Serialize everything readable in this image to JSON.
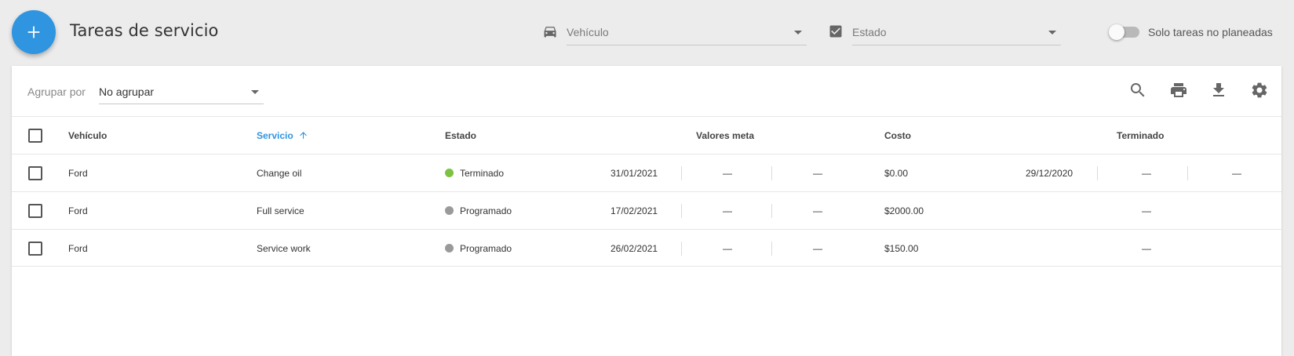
{
  "header": {
    "title": "Tareas de servicio",
    "vehicle_filter_placeholder": "Vehículo",
    "status_filter_placeholder": "Estado",
    "unplanned_toggle_label": "Solo tareas no planeadas",
    "unplanned_toggle_on": false
  },
  "toolbar": {
    "group_by_label": "Agrupar por",
    "group_by_value": "No agrupar"
  },
  "table": {
    "columns": {
      "vehicle": "Vehículo",
      "service": "Servicio",
      "status": "Estado",
      "target_values": "Valores meta",
      "cost": "Costo",
      "finished": "Terminado"
    },
    "rows": [
      {
        "vehicle": "Ford",
        "service": "Change oil",
        "status": "Terminado",
        "status_color": "#7dc242",
        "target_date": "31/01/2021",
        "target_v1": "—",
        "target_v2": "—",
        "cost": "$0.00",
        "finished_date": "29/12/2020",
        "finished_v1": "—",
        "finished_v2": "—"
      },
      {
        "vehicle": "Ford",
        "service": "Full service",
        "status": "Programado",
        "status_color": "#9a9a9a",
        "target_date": "17/02/2021",
        "target_v1": "—",
        "target_v2": "—",
        "cost": "$2000.00",
        "finished_date": "",
        "finished_v1": "—",
        "finished_v2": ""
      },
      {
        "vehicle": "Ford",
        "service": "Service work",
        "status": "Programado",
        "status_color": "#9a9a9a",
        "target_date": "26/02/2021",
        "target_v1": "—",
        "target_v2": "—",
        "cost": "$150.00",
        "finished_date": "",
        "finished_v1": "—",
        "finished_v2": ""
      }
    ]
  },
  "colors": {
    "accent": "#2f95e0",
    "finished": "#7dc242",
    "scheduled": "#9a9a9a"
  }
}
